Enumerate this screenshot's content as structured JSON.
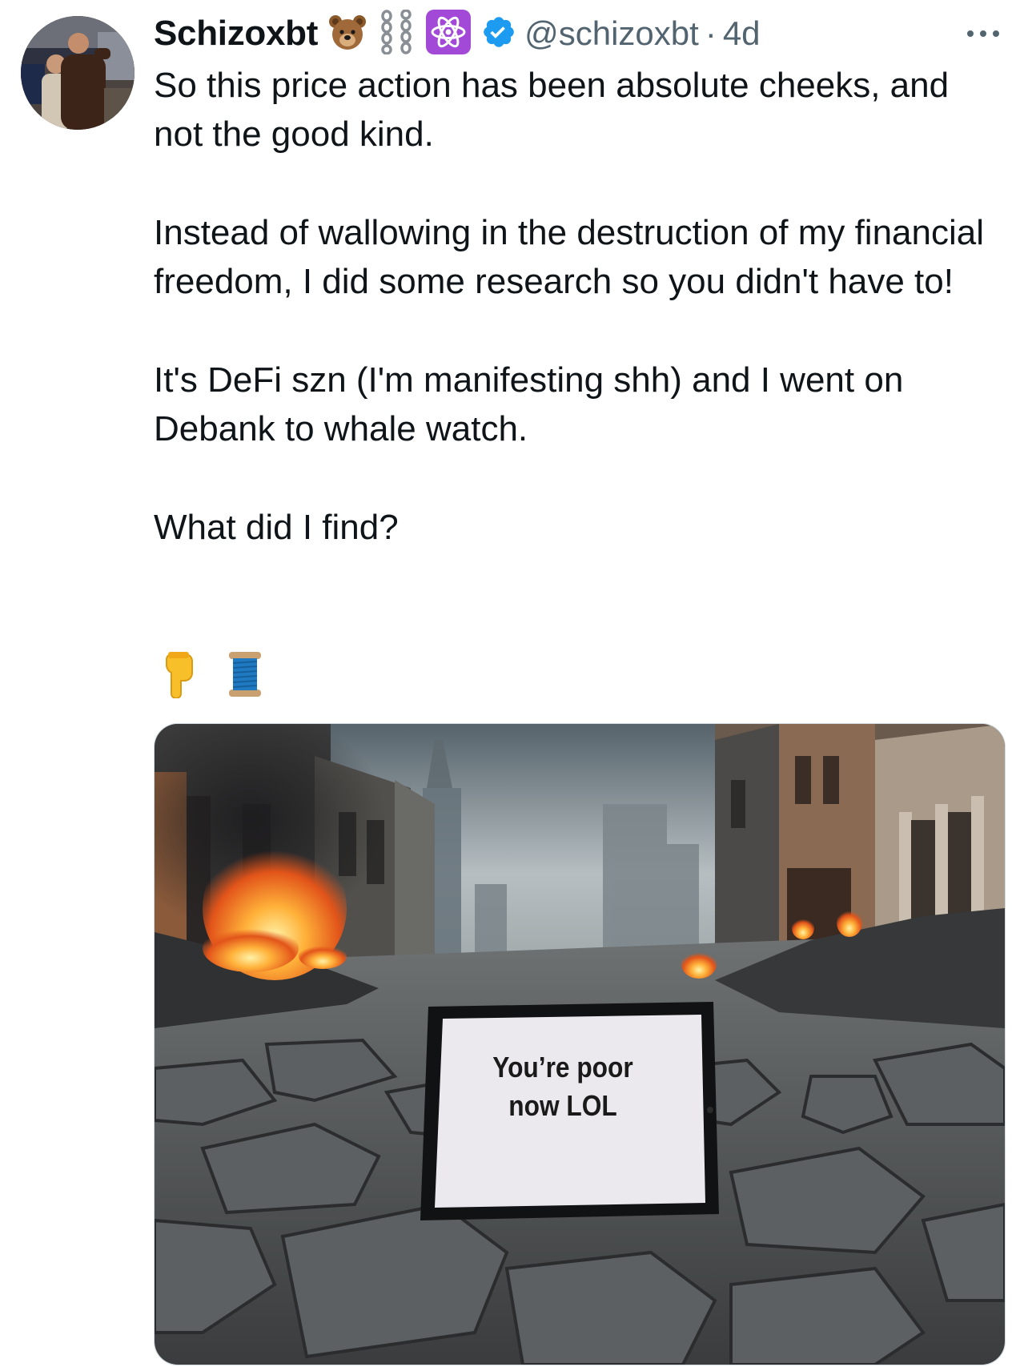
{
  "tweet": {
    "display_name": "Schizoxbt",
    "name_emojis": [
      "bear-face-emoji",
      "chains-emoji",
      "atom-symbol-emoji"
    ],
    "verified": true,
    "handle": "@schizoxbt",
    "separator": "·",
    "timestamp": "4d",
    "more_label": "More",
    "paragraphs": [
      "So this price action has been absolute cheeks, and not the good kind.",
      "Instead of wallowing in the destruction of my financial freedom, I did some research so you didn't have to!",
      "It's DeFi szn (I'm manifesting shh) and I went on Debank to whale watch.",
      "What did I find?"
    ],
    "trailing_emojis": [
      "backhand-index-pointing-down-emoji",
      "spool-of-thread-emoji"
    ]
  },
  "media": {
    "image_text": "You’re poor now LOL",
    "image_text_line1": "You’re poor",
    "image_text_line2": "now LOL"
  },
  "colors": {
    "text_primary": "#0f1419",
    "text_secondary": "#536471",
    "verified_blue": "#1d9bf0",
    "atom_badge_purple": "#a349d8",
    "border": "#cfd9de"
  }
}
